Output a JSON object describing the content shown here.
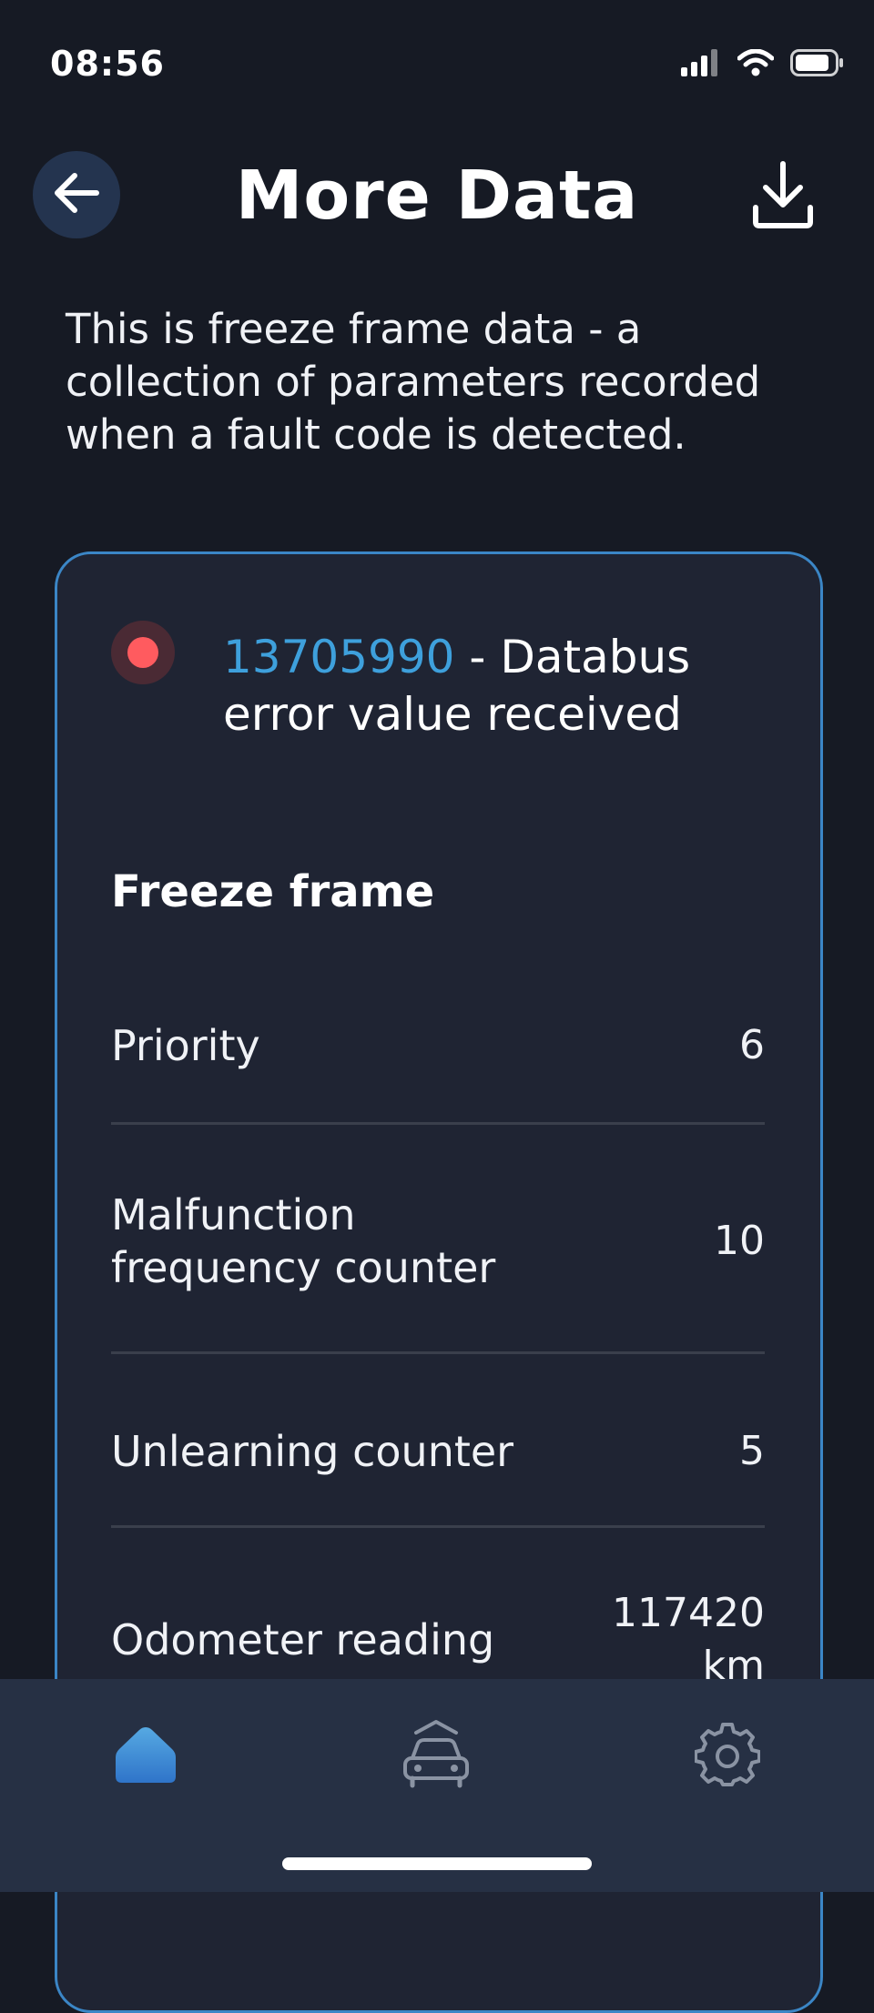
{
  "status_bar": {
    "time": "08:56",
    "icons": [
      "signal-icon",
      "wifi-icon",
      "battery-icon"
    ]
  },
  "header": {
    "title": "More Data",
    "back_icon": "arrow-left-icon",
    "download_icon": "download-icon"
  },
  "intro_text": "This is freeze frame data - a collection of parameters recorded when a fault code is detected.",
  "fault": {
    "code": "13705990",
    "separator": " - ",
    "description": "Databus error value received",
    "status_color": "#ff5b5f"
  },
  "freeze_frame": {
    "title": "Freeze frame",
    "rows": [
      {
        "label": "Priority",
        "value": "6"
      },
      {
        "label": "Malfunction frequency counter",
        "value": "10"
      },
      {
        "label": "Unlearning counter",
        "value": "5"
      },
      {
        "label": "Odometer reading",
        "value": "117420 km"
      }
    ]
  },
  "bottom_nav": {
    "items": [
      {
        "icon": "home-icon",
        "active": true
      },
      {
        "icon": "car-icon",
        "active": false
      },
      {
        "icon": "gear-icon",
        "active": false
      }
    ]
  },
  "colors": {
    "background": "#161a24",
    "card": "#1f2433",
    "accent": "#3b86c6",
    "code_blue": "#3ea0dc",
    "nav_bar": "#263044"
  }
}
